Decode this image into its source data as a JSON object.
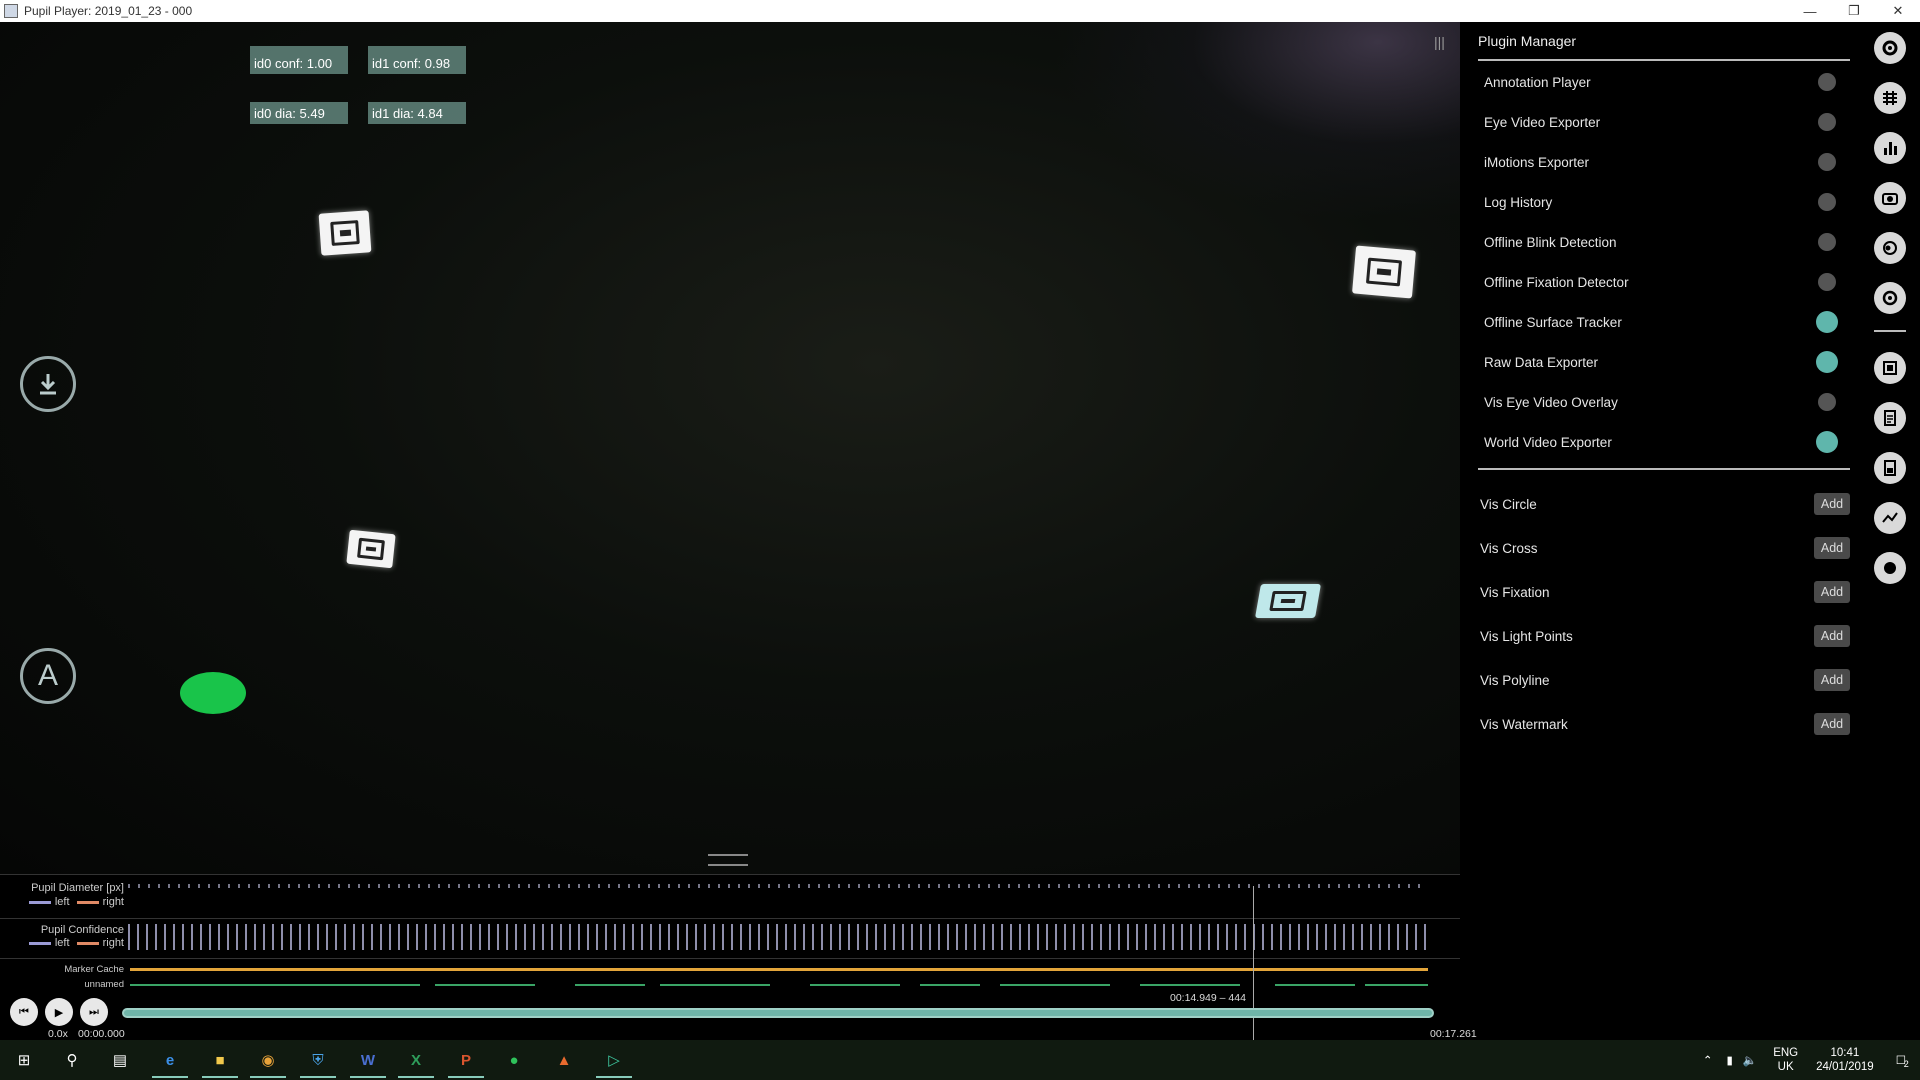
{
  "window": {
    "title": "Pupil Player: 2019_01_23 - 000",
    "minimize_icon": "minimize-icon",
    "maximize_icon": "restore-icon",
    "close_icon": "close-icon"
  },
  "video": {
    "id0_conf": "id0 conf: 1.00",
    "id1_conf": "id1 conf: 0.98",
    "id0_dia": "id0 dia: 5.49",
    "id1_dia": "id1 dia: 4.84",
    "auto_label": "A",
    "download_icon": "download-icon",
    "menu_icon": "menu-icon",
    "menu_glyph": "|||"
  },
  "plugin_manager": {
    "title": "Plugin Manager",
    "plugins": [
      {
        "label": "Annotation Player",
        "enabled": false
      },
      {
        "label": "Eye Video Exporter",
        "enabled": false
      },
      {
        "label": "iMotions Exporter",
        "enabled": false
      },
      {
        "label": "Log History",
        "enabled": false
      },
      {
        "label": "Offline Blink Detection",
        "enabled": false
      },
      {
        "label": "Offline Fixation Detector",
        "enabled": false
      },
      {
        "label": "Offline Surface Tracker",
        "enabled": true
      },
      {
        "label": "Raw Data Exporter",
        "enabled": true
      },
      {
        "label": "Vis Eye Video Overlay",
        "enabled": false
      },
      {
        "label": "World Video Exporter",
        "enabled": true
      }
    ],
    "vis_plugins": [
      {
        "label": "Vis Circle",
        "button": "Add"
      },
      {
        "label": "Vis Cross",
        "button": "Add"
      },
      {
        "label": "Vis Fixation",
        "button": "Add"
      },
      {
        "label": "Vis Light Points",
        "button": "Add"
      },
      {
        "label": "Vis Polyline",
        "button": "Add"
      },
      {
        "label": "Vis Watermark",
        "button": "Add"
      }
    ],
    "toggle_on_color": "#5fb6ac",
    "toggle_off_color": "#555555"
  },
  "icon_bar": [
    "gear-icon",
    "surface-grid-icon",
    "bar-chart-icon",
    "camera-icon",
    "eye-icon",
    "record-target-icon",
    "export-icon",
    "document-icon",
    "save-icon",
    "line-graph-icon",
    "record-dot-icon"
  ],
  "timeline": {
    "pupil_diameter_label": "Pupil Diameter [px]",
    "pupil_confidence_label": "Pupil Confidence",
    "left_label": "left",
    "right_label": "right",
    "left_color": "#9b9bd6",
    "right_color": "#e08a66",
    "marker_cache_label": "Marker Cache",
    "unnamed_label": "unnamed",
    "marker_cache_color": "#e3a53a",
    "surface_color": "#3aa466",
    "current_time": "00:14.949 – 444",
    "start_time": "00:00.000",
    "end_time": "00:17.261",
    "speed": "0.0x",
    "scrub_color": "#6fb5a9"
  },
  "taskbar": {
    "icons": [
      "windows-start-icon",
      "search-icon",
      "task-view-icon",
      "edge-icon",
      "file-explorer-icon",
      "chrome-icon",
      "security-icon",
      "word-icon",
      "excel-icon",
      "powerpoint-icon",
      "spotify-icon",
      "matlab-icon",
      "pupil-player-icon"
    ],
    "language": "ENG",
    "region": "UK",
    "time": "10:41",
    "date": "24/01/2019",
    "notifications": "2"
  }
}
